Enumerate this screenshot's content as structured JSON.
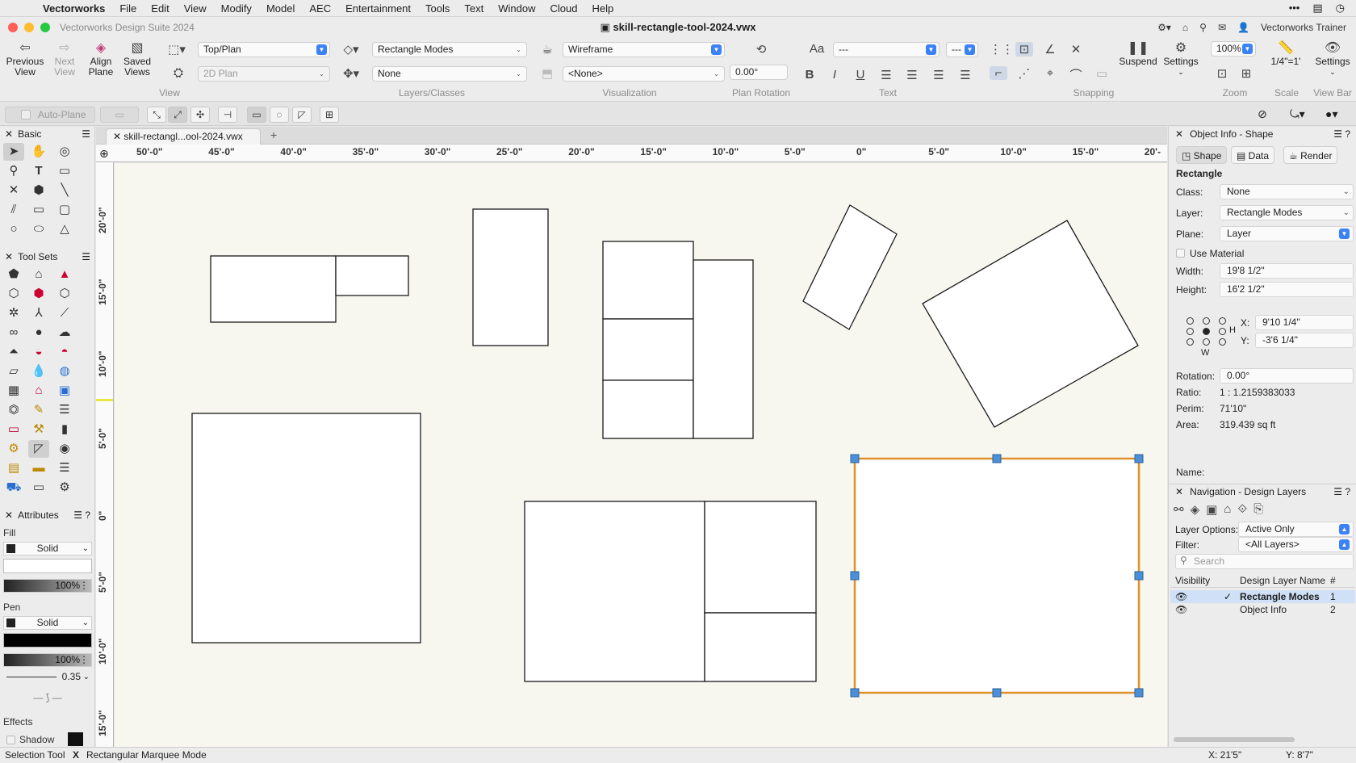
{
  "menubar": {
    "app_name": "Vectorworks",
    "items": [
      "File",
      "Edit",
      "View",
      "Modify",
      "Model",
      "AEC",
      "Entertainment",
      "Tools",
      "Text",
      "Window",
      "Cloud",
      "Help"
    ]
  },
  "titlebar": {
    "app_title": "Vectorworks Design Suite 2024",
    "doc_title": "skill-rectangle-tool-2024.vwx",
    "user": "Vectorworks Trainer"
  },
  "toolbar": {
    "previous_view": "Previous View",
    "next_view": "Next View",
    "align_plane": "Align Plane",
    "saved_views": "Saved Views",
    "view_select": "Top/Plan",
    "plane_select": "2D Plan",
    "layer_select": "Rectangle Modes",
    "class_select": "None",
    "render_select": "Wireframe",
    "render_3d_select": "<None>",
    "plan_rotation": "0.00°",
    "font_select": "---",
    "size_select": "---",
    "suspend": "Suspend",
    "settings": "Settings",
    "zoom": "100%",
    "scale": "1/4\"=1'",
    "view_bar_settings": "Settings",
    "group_view": "View",
    "group_layers": "Layers/Classes",
    "group_visualization": "Visualization",
    "group_plan_rotation": "Plan Rotation",
    "group_text": "Text",
    "group_snapping": "Snapping",
    "group_zoom": "Zoom",
    "group_scale": "Scale",
    "group_view_bar": "View Bar",
    "auto_plane": "Auto-Plane",
    "font_icon": "Aa"
  },
  "left": {
    "basic_title": "Basic",
    "toolsets_title": "Tool Sets",
    "attributes_title": "Attributes",
    "fill_label": "Fill",
    "fill_style": "Solid",
    "fill_opacity": "100%",
    "pen_label": "Pen",
    "pen_style": "Solid",
    "pen_opacity": "100%",
    "line_weight": "0.35",
    "effects_label": "Effects",
    "shadow_label": "Shadow",
    "fill_color": "#ffffff",
    "pen_color": "#000000"
  },
  "document": {
    "tab_label": "skill-rectangl...ool-2024.vwx",
    "hruler_labels": [
      "50'-0\"",
      "45'-0\"",
      "40'-0\"",
      "35'-0\"",
      "30'-0\"",
      "25'-0\"",
      "20'-0\"",
      "15'-0\"",
      "10'-0\"",
      "5'-0\"",
      "0\"",
      "5'-0\"",
      "10'-0\"",
      "15'-0\"",
      "20'-"
    ],
    "vruler_labels": [
      "20'-0\"",
      "15'-0\"",
      "10'-0\"",
      "5'-0\"",
      "0\"",
      "5'-0\"",
      "10'-0\"",
      "15'-0\""
    ]
  },
  "object_info": {
    "title": "Object Info - Shape",
    "tabs": [
      "Shape",
      "Data",
      "Render"
    ],
    "object_type": "Rectangle",
    "class_label": "Class:",
    "class_value": "None",
    "layer_label": "Layer:",
    "layer_value": "Rectangle Modes",
    "plane_label": "Plane:",
    "plane_value": "Layer",
    "use_material": "Use Material",
    "width_label": "Width:",
    "width_value": "19'8 1/2\"",
    "height_label": "Height:",
    "height_value": "16'2 1/2\"",
    "x_label": "X:",
    "x_value": "9'10 1/4\"",
    "y_label": "Y:",
    "y_value": "-3'6 1/4\"",
    "h_label": "H",
    "w_label": "W",
    "rotation_label": "Rotation:",
    "rotation_value": "0.00°",
    "ratio_label": "Ratio:",
    "ratio_value": "1 : 1.2159383033",
    "perim_label": "Perim:",
    "perim_value": "71'10\"",
    "area_label": "Area:",
    "area_value": "319.439 sq ft",
    "name_label": "Name:"
  },
  "navigation": {
    "title": "Navigation - Design Layers",
    "layer_options_label": "Layer Options:",
    "layer_options_value": "Active Only",
    "filter_label": "Filter:",
    "filter_value": "<All Layers>",
    "search_placeholder": "Search",
    "col_visibility": "Visibility",
    "col_name": "Design Layer Name",
    "col_num": "#",
    "layers": [
      {
        "name": "Rectangle Modes",
        "num": "1",
        "active": true
      },
      {
        "name": "Object Info",
        "num": "2",
        "active": false
      }
    ]
  },
  "status": {
    "tool": "Selection Tool",
    "mode": "Rectangular Marquee Mode",
    "x_readout": "X: 21'5\"",
    "y_readout": "Y: 8'7\""
  },
  "colors": {
    "selection": "#e0902a",
    "handle": "#4a90d9",
    "accent": "#3b82f6",
    "canvas": "#f8f7ef"
  }
}
